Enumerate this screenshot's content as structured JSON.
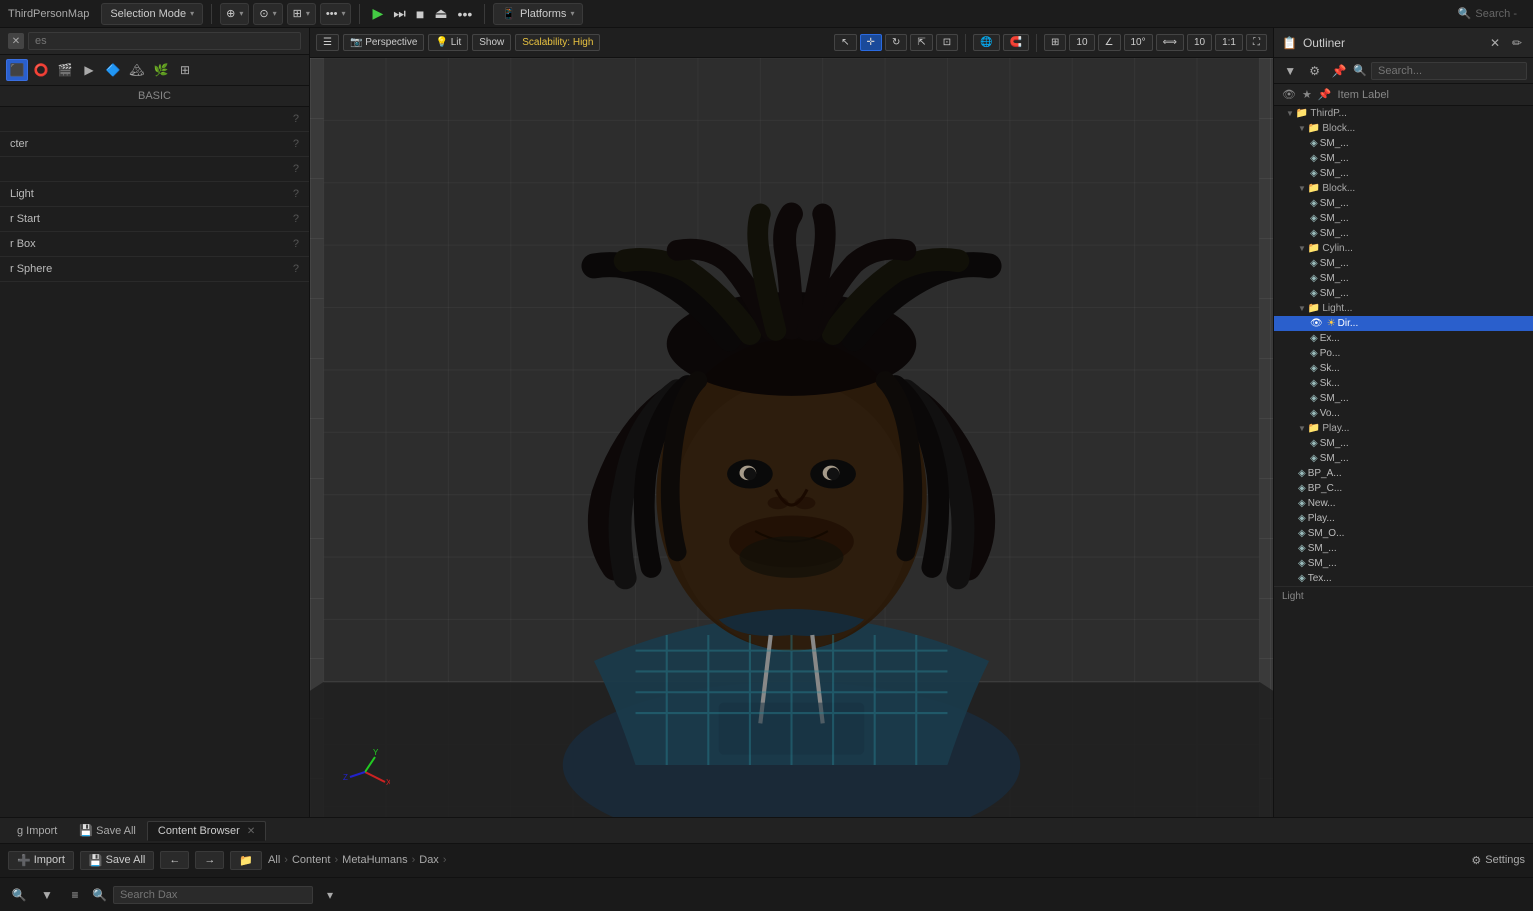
{
  "window": {
    "title": "ThirdPersonMap"
  },
  "topMenubar": {
    "title": "ThirdPersonMap",
    "selectionMode": {
      "label": "Selection Mode",
      "arrow": "▾"
    },
    "tools": [
      {
        "label": "⊕",
        "id": "add-tool"
      },
      {
        "label": "⊙",
        "id": "transform-tool"
      },
      {
        "label": "⊞",
        "id": "grid-tool"
      }
    ],
    "moreBtn": "...",
    "playBtn": "▶",
    "pauseBtn": "⏸",
    "stopBtn": "■",
    "ejectBtn": "⏏",
    "platforms": {
      "label": "Platforms",
      "arrow": "▾"
    }
  },
  "leftPanel": {
    "searchPlaceholder": "es",
    "basicLabel": "BASIC",
    "items": [
      {
        "text": "",
        "hasHelp": true
      },
      {
        "text": "cter",
        "hasHelp": true
      },
      {
        "text": "",
        "hasHelp": true
      },
      {
        "text": "Light",
        "hasHelp": true
      },
      {
        "text": "r Start",
        "hasHelp": true
      },
      {
        "text": "r Box",
        "hasHelp": true
      },
      {
        "text": "r Sphere",
        "hasHelp": true
      }
    ]
  },
  "viewport": {
    "perspectiveLabel": "Perspective",
    "litLabel": "Lit",
    "showLabel": "Show",
    "scalabilityLabel": "Scalability: High",
    "toolbar": {
      "buttons": [
        "☰",
        "📷",
        "💡",
        "👁",
        "⊞",
        "🔘",
        "📐"
      ]
    },
    "rightButtons": {
      "numbers": [
        "10",
        "10°",
        "10"
      ],
      "ratio": "1:1"
    }
  },
  "outliner": {
    "title": "Outliner",
    "searchPlaceholder": "Search...",
    "colHeader": "Item Label",
    "items": [
      {
        "indent": 0,
        "type": "folder",
        "label": "ThirdP...",
        "id": "root-folder"
      },
      {
        "indent": 1,
        "type": "folder",
        "label": "Block...",
        "id": "block1"
      },
      {
        "indent": 2,
        "type": "mesh",
        "label": "SM_...",
        "id": "sm1"
      },
      {
        "indent": 2,
        "type": "mesh",
        "label": "SM_...",
        "id": "sm2"
      },
      {
        "indent": 2,
        "type": "mesh",
        "label": "SM_...",
        "id": "sm3"
      },
      {
        "indent": 1,
        "type": "folder",
        "label": "Block...",
        "id": "block2"
      },
      {
        "indent": 2,
        "type": "mesh",
        "label": "SM_...",
        "id": "sm4"
      },
      {
        "indent": 2,
        "type": "mesh",
        "label": "SM_...",
        "id": "sm5"
      },
      {
        "indent": 2,
        "type": "mesh",
        "label": "SM_...",
        "id": "sm6"
      },
      {
        "indent": 1,
        "type": "folder",
        "label": "Cylin...",
        "id": "cylin"
      },
      {
        "indent": 2,
        "type": "mesh",
        "label": "SM_...",
        "id": "sm7"
      },
      {
        "indent": 2,
        "type": "mesh",
        "label": "SM_...",
        "id": "sm8"
      },
      {
        "indent": 2,
        "type": "mesh",
        "label": "SM_...",
        "id": "sm9"
      },
      {
        "indent": 1,
        "type": "folder",
        "label": "Light...",
        "id": "lights"
      },
      {
        "indent": 2,
        "type": "mesh",
        "label": "Dir...",
        "id": "dir-light",
        "selected": true
      },
      {
        "indent": 2,
        "type": "mesh",
        "label": "Ex...",
        "id": "ex"
      },
      {
        "indent": 2,
        "type": "mesh",
        "label": "Po...",
        "id": "po"
      },
      {
        "indent": 2,
        "type": "mesh",
        "label": "Sk...",
        "id": "sk1"
      },
      {
        "indent": 2,
        "type": "mesh",
        "label": "Sk...",
        "id": "sk2"
      },
      {
        "indent": 2,
        "type": "mesh",
        "label": "SM_...",
        "id": "sm10"
      },
      {
        "indent": 2,
        "type": "mesh",
        "label": "Vo...",
        "id": "vo"
      },
      {
        "indent": 1,
        "type": "folder",
        "label": "Play...",
        "id": "players"
      },
      {
        "indent": 2,
        "type": "mesh",
        "label": "SM_...",
        "id": "sm11"
      },
      {
        "indent": 2,
        "type": "mesh",
        "label": "SM_...",
        "id": "sm12"
      },
      {
        "indent": 1,
        "type": "mesh",
        "label": "BP_A...",
        "id": "bpa"
      },
      {
        "indent": 1,
        "type": "mesh",
        "label": "BP_C...",
        "id": "bpc"
      },
      {
        "indent": 1,
        "type": "mesh",
        "label": "New...",
        "id": "new"
      },
      {
        "indent": 1,
        "type": "mesh",
        "label": "Play...",
        "id": "play"
      },
      {
        "indent": 1,
        "type": "mesh",
        "label": "SM_O...",
        "id": "smo"
      },
      {
        "indent": 1,
        "type": "mesh",
        "label": "SM_...",
        "id": "sm13"
      },
      {
        "indent": 1,
        "type": "mesh",
        "label": "SM_...",
        "id": "sm14"
      },
      {
        "indent": 1,
        "type": "mesh",
        "label": "Tex...",
        "id": "tex"
      }
    ]
  },
  "bottomBar": {
    "tabs": [
      {
        "label": "g Import",
        "active": false
      },
      {
        "label": "Save All",
        "active": false
      },
      {
        "label": "← All > Content > MetaHumans > Dax >",
        "active": false
      }
    ],
    "breadcrumb": [
      "All",
      "Content",
      "MetaHumans",
      "Dax"
    ],
    "searchPlaceholder": "Search Dax",
    "settingsLabel": "Settings",
    "activeTab": "Content Browser"
  },
  "colors": {
    "accent": "#2a5fcc",
    "selected": "#2a5fcc",
    "yellow": "#e8c240",
    "green": "#44cc44",
    "bg_dark": "#1a1a1a",
    "bg_panel": "#1e1e1e",
    "scalability_yellow": "#e8c240"
  }
}
